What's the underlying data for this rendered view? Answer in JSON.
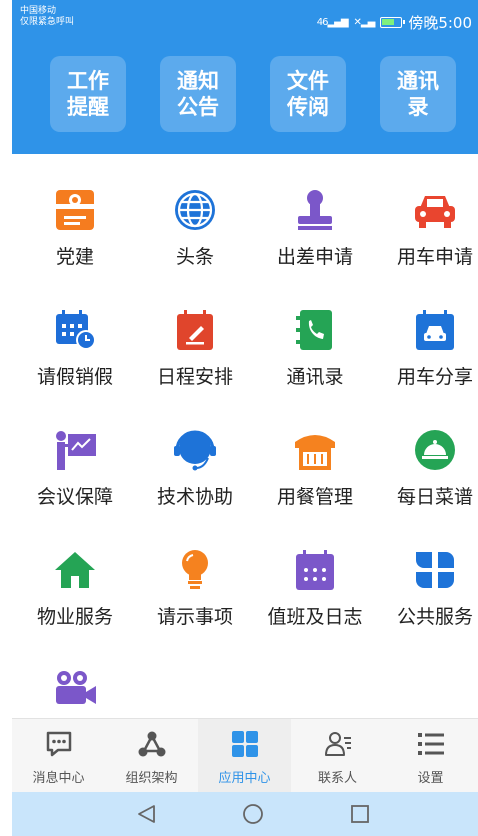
{
  "status": {
    "carrier_line1": "中国移动",
    "carrier_line2": "仅限紧急呼叫",
    "signal": "46",
    "time": "傍晚5:00"
  },
  "quick_tiles": [
    {
      "label": "工作提醒"
    },
    {
      "label": "通知公告"
    },
    {
      "label": "文件传阅"
    },
    {
      "label": "通讯录"
    }
  ],
  "apps": [
    {
      "label": "党建",
      "icon": "party-building-icon",
      "color": "#f57c1f"
    },
    {
      "label": "头条",
      "icon": "globe-icon",
      "color": "#1e73d8"
    },
    {
      "label": "出差申请",
      "icon": "stamp-icon",
      "color": "#7b57c9"
    },
    {
      "label": "用车申请",
      "icon": "car-icon",
      "color": "#e9452f"
    },
    {
      "label": "请假销假",
      "icon": "calendar-clock-icon",
      "color": "#1e6ed8"
    },
    {
      "label": "日程安排",
      "icon": "calendar-edit-icon",
      "color": "#e0452c"
    },
    {
      "label": "通讯录",
      "icon": "phone-book-icon",
      "color": "#25a455"
    },
    {
      "label": "用车分享",
      "icon": "car-share-icon",
      "color": "#1e73d8"
    },
    {
      "label": "会议保障",
      "icon": "presentation-icon",
      "color": "#7b57c9"
    },
    {
      "label": "技术协助",
      "icon": "headset-icon",
      "color": "#1e73d8"
    },
    {
      "label": "用餐管理",
      "icon": "restaurant-icon",
      "color": "#f5821f"
    },
    {
      "label": "每日菜谱",
      "icon": "dish-cloche-icon",
      "color": "#25a455"
    },
    {
      "label": "物业服务",
      "icon": "home-icon",
      "color": "#25a455"
    },
    {
      "label": "请示事项",
      "icon": "lightbulb-icon",
      "color": "#f5821f"
    },
    {
      "label": "值班及日志",
      "icon": "calendar-grid-icon",
      "color": "#7b57c9"
    },
    {
      "label": "公共服务",
      "icon": "four-petal-icon",
      "color": "#1e73d8"
    },
    {
      "label": "",
      "icon": "video-camera-icon",
      "color": "#7b57c9"
    }
  ],
  "tabs": [
    {
      "label": "消息中心",
      "icon": "message-icon"
    },
    {
      "label": "组织架构",
      "icon": "org-chart-icon"
    },
    {
      "label": "应用中心",
      "icon": "app-grid-icon"
    },
    {
      "label": "联系人",
      "icon": "contacts-icon"
    },
    {
      "label": "设置",
      "icon": "menu-list-icon"
    }
  ],
  "active_tab": "应用中心",
  "colors": {
    "primary": "#2f93e8",
    "nav_bg": "#c9e5fb"
  }
}
